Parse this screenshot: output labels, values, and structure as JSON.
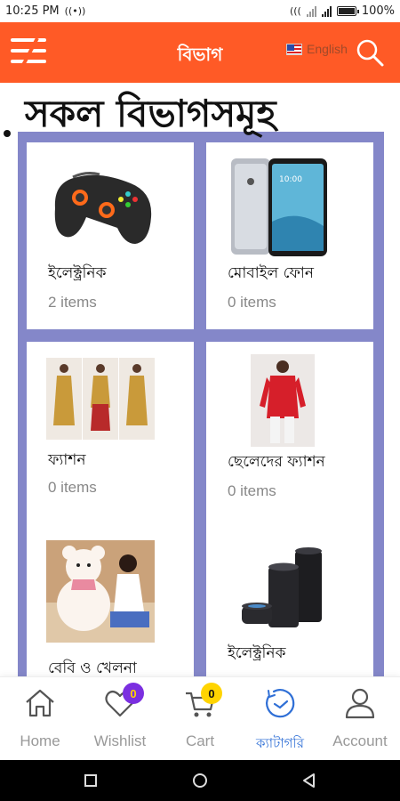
{
  "status_bar": {
    "time": "10:25 PM",
    "battery": "100%"
  },
  "header": {
    "title": "বিভাগ",
    "language_label": "English"
  },
  "page": {
    "heading": "সকল বিভাগসমূহ"
  },
  "categories": [
    {
      "name": "ইলেক্ট্রনিক",
      "count": "2 items",
      "icon": "gamepad-image"
    },
    {
      "name": "মোবাইল ফোন",
      "count": "0 items",
      "icon": "smartphone-image"
    },
    {
      "name": "ফ্যাশন",
      "count": "0 items",
      "icon": "womens-fashion-image"
    },
    {
      "name": "ছেলেদের ফ্যাশন",
      "count": "0 items",
      "icon": "mens-fashion-image"
    },
    {
      "name": "বেবি ও খেলনা",
      "count": "",
      "icon": "teddy-bear-image"
    },
    {
      "name": "ইলেক্ট্রনিক",
      "count": "",
      "icon": "smart-speaker-image"
    }
  ],
  "bottom_nav": {
    "items": [
      {
        "label": "Home",
        "icon": "home-icon"
      },
      {
        "label": "Wishlist",
        "icon": "heart-icon",
        "badge": "0"
      },
      {
        "label": "Cart",
        "icon": "cart-icon",
        "badge": "0"
      },
      {
        "label": "ক্যাটাগরি",
        "icon": "category-icon",
        "active": true
      },
      {
        "label": "Account",
        "icon": "account-icon"
      }
    ]
  },
  "colors": {
    "header_bg": "#ff5a26",
    "grid_bg": "#8487c9",
    "active_nav": "#2f6fd6",
    "wishlist_badge": "#7b2fe0",
    "cart_badge": "#ffd400"
  }
}
